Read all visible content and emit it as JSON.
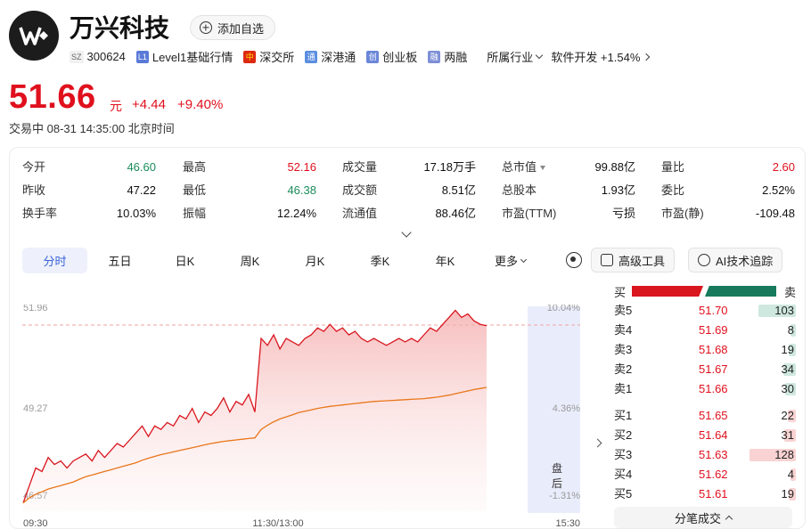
{
  "header": {
    "name": "万兴科技",
    "watch_label": "添加自选",
    "exchange_badge": "SZ",
    "code": "300624",
    "level_badge": "L1",
    "level_label": "Level1基础行情",
    "cn_badge": "中",
    "market": "深交所",
    "hk_badge": "通",
    "connect": "深港通",
    "cy_badge": "创",
    "board": "创业板",
    "rz_badge": "融",
    "margin": "两融",
    "industry_label": "所属行业",
    "sector": "软件开发 +1.54%"
  },
  "quote": {
    "price": "51.66",
    "unit": "元",
    "change": "+4.44",
    "change_pct": "+9.40%",
    "status": "交易中  08-31 14:35:00 北京时间"
  },
  "stats": [
    [
      {
        "k": "今开",
        "v": "46.60",
        "c": "green"
      },
      {
        "k": "最高",
        "v": "52.16",
        "c": "red"
      },
      {
        "k": "成交量",
        "v": "17.18万手",
        "c": ""
      },
      {
        "k": "总市值",
        "v": "99.88亿",
        "c": "",
        "tri": true
      },
      {
        "k": "量比",
        "v": "2.60",
        "c": "red"
      }
    ],
    [
      {
        "k": "昨收",
        "v": "47.22",
        "c": ""
      },
      {
        "k": "最低",
        "v": "46.38",
        "c": "green"
      },
      {
        "k": "成交额",
        "v": "8.51亿",
        "c": ""
      },
      {
        "k": "总股本",
        "v": "1.93亿",
        "c": ""
      },
      {
        "k": "委比",
        "v": "2.52%",
        "c": ""
      }
    ],
    [
      {
        "k": "换手率",
        "v": "10.03%",
        "c": ""
      },
      {
        "k": "振幅",
        "v": "12.24%",
        "c": ""
      },
      {
        "k": "流通值",
        "v": "88.46亿",
        "c": ""
      },
      {
        "k": "市盈(TTM)",
        "v": "亏损",
        "c": ""
      },
      {
        "k": "市盈(静)",
        "v": "-109.48",
        "c": ""
      }
    ]
  ],
  "tabs": [
    "分时",
    "五日",
    "日K",
    "周K",
    "月K",
    "季K",
    "年K",
    "更多"
  ],
  "tools": {
    "advanced": "高级工具",
    "ai": "AI技术追踪"
  },
  "chart_data": {
    "type": "line",
    "x_labels": [
      "09:30",
      "11:30/13:00",
      "15:30"
    ],
    "y_left_ticks": [
      "51.96",
      "49.27",
      "46.57"
    ],
    "y_right_ticks": [
      "10.04%",
      "4.36%",
      "-1.31%"
    ],
    "after_hours_label": "盘后",
    "ylim": [
      46.57,
      51.96
    ],
    "reference_price": 47.22,
    "high_line": 51.96,
    "series": [
      {
        "name": "",
        "color": "#d9151e",
        "values": [
          46.6,
          47.1,
          47.6,
          47.5,
          47.9,
          47.7,
          47.8,
          47.6,
          47.8,
          47.9,
          48.0,
          47.8,
          48.1,
          47.9,
          48.1,
          48.3,
          48.2,
          48.4,
          48.6,
          48.8,
          48.5,
          48.8,
          48.7,
          48.9,
          48.8,
          49.1,
          49.0,
          49.3,
          48.9,
          49.2,
          49.1,
          49.3,
          49.6,
          49.2,
          49.5,
          49.4,
          49.7,
          49.2,
          51.3,
          51.1,
          51.4,
          51.0,
          51.3,
          51.2,
          51.1,
          51.3,
          51.4,
          51.6,
          51.5,
          51.7,
          51.5,
          51.6,
          51.4,
          51.5,
          51.3,
          51.2,
          51.3,
          51.2,
          51.1,
          51.2,
          51.3,
          51.2,
          51.3,
          51.2,
          51.4,
          51.6,
          51.5,
          51.7,
          51.9,
          52.1,
          51.9,
          52.0,
          51.8,
          51.7,
          51.66
        ]
      },
      {
        "name": "",
        "color": "#e8761a",
        "values": [
          46.6,
          46.75,
          46.85,
          46.92,
          47.0,
          47.05,
          47.1,
          47.15,
          47.2,
          47.28,
          47.35,
          47.4,
          47.45,
          47.5,
          47.55,
          47.6,
          47.65,
          47.7,
          47.75,
          47.82,
          47.88,
          47.93,
          47.98,
          48.02,
          48.06,
          48.1,
          48.14,
          48.18,
          48.22,
          48.26,
          48.3,
          48.33,
          48.36,
          48.38,
          48.4,
          48.42,
          48.44,
          48.46,
          48.7,
          48.82,
          48.92,
          49.0,
          49.06,
          49.12,
          49.18,
          49.22,
          49.26,
          49.3,
          49.33,
          49.36,
          49.38,
          49.4,
          49.42,
          49.44,
          49.46,
          49.48,
          49.5,
          49.51,
          49.52,
          49.53,
          49.54,
          49.55,
          49.56,
          49.57,
          49.58,
          49.6,
          49.62,
          49.65,
          49.68,
          49.72,
          49.76,
          49.8,
          49.84,
          49.87,
          49.9
        ]
      }
    ],
    "total_slots": 242
  },
  "order_book": {
    "buy_label": "买",
    "sell_label": "卖",
    "asks": [
      {
        "l": "卖5",
        "p": "51.70",
        "v": 103
      },
      {
        "l": "卖4",
        "p": "51.69",
        "v": 8
      },
      {
        "l": "卖3",
        "p": "51.68",
        "v": 19
      },
      {
        "l": "卖2",
        "p": "51.67",
        "v": 34
      },
      {
        "l": "卖1",
        "p": "51.66",
        "v": 30
      }
    ],
    "bids": [
      {
        "l": "买1",
        "p": "51.65",
        "v": 22
      },
      {
        "l": "买2",
        "p": "51.64",
        "v": 31
      },
      {
        "l": "买3",
        "p": "51.63",
        "v": 128
      },
      {
        "l": "买4",
        "p": "51.62",
        "v": 4
      },
      {
        "l": "买5",
        "p": "51.61",
        "v": 19
      }
    ],
    "ticks_label": "分笔成交"
  }
}
